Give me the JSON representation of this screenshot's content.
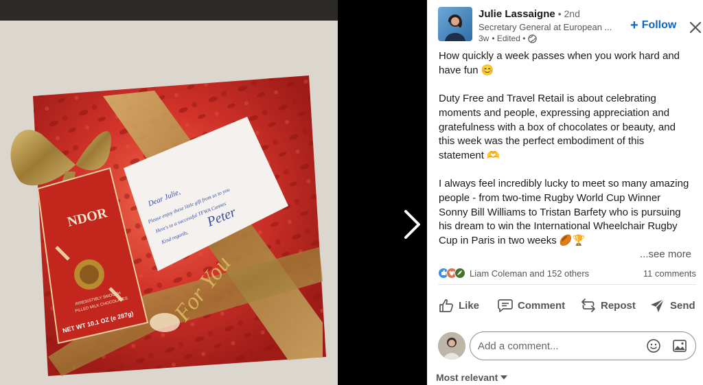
{
  "author": {
    "name": "Julie Lassaigne",
    "degree": "• 2nd",
    "headline": "Secretary General at European ...",
    "time": "3w",
    "edited": "• Edited •"
  },
  "follow_label": "Follow",
  "post": {
    "paragraphs": [
      "How quickly a week passes when you work hard and have fun 😊",
      "Duty Free and Travel Retail is about celebrating moments and people, expressing appreciation and gratefulness with a box of chocolates or beauty, and this week was the perfect embodiment of this statement 🫶",
      "I always feel incredibly lucky to meet so many amazing people - from two-time Rugby World Cup Winner Sonny Bill Williams to Tristan Barfety who is pursuing his dream to win the International Wheelchair Rugby Cup in Paris in two weeks 🏉🏆"
    ],
    "see_more": "...see more"
  },
  "social": {
    "reactions_text": "Liam Coleman and 152 others",
    "comments_text": "11 comments"
  },
  "actions": {
    "like": "Like",
    "comment": "Comment",
    "repost": "Repost",
    "send": "Send"
  },
  "comment_box": {
    "placeholder": "Add a comment..."
  },
  "sort_label": "Most relevant",
  "photo": {
    "box_brand": "NDOR",
    "box_tagline": "IRRESISTIBLY SMOOTH",
    "box_product": "FILLED MILK CHOCOLATES",
    "box_weight": "NET WT 10.1 OZ (e 287g)",
    "gold_text": "For You",
    "card_greeting": "Dear Julie,",
    "card_line1": "Please enjoy these little gift from us to you",
    "card_line2": "Here's to a successful TFWA Cannes",
    "card_line3": "Kind regards,",
    "card_sign": "Peter"
  },
  "colors": {
    "brand_blue": "#0a66c2",
    "wrapping_red": "#c8281f",
    "ribbon_gold": "#b9964a"
  },
  "icons": [
    "globe-icon",
    "close-icon",
    "chevron-right-icon",
    "like-icon",
    "comment-icon",
    "repost-icon",
    "send-icon",
    "emoji-icon",
    "image-icon",
    "caret-down-icon"
  ]
}
